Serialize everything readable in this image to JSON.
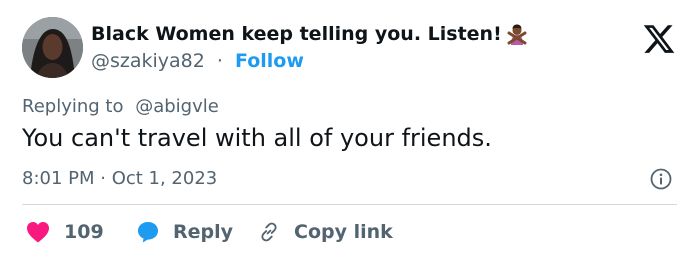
{
  "tweet": {
    "author": {
      "display_name": "Black Women keep telling you. Listen!",
      "emoji_icon": "person-gesturing-no-emoji",
      "handle": "@szakiya82",
      "separator": "·",
      "follow_label": "Follow"
    },
    "replying_prefix": "Replying to",
    "replying_to": "@abigvle",
    "text": "You can't travel with all of your friends.",
    "timestamp": "8:01 PM · Oct 1, 2023",
    "actions": {
      "like_count": "109",
      "reply_label": "Reply",
      "copy_link_label": "Copy link"
    }
  },
  "colors": {
    "text_primary": "#0f1419",
    "text_secondary": "#536471",
    "link_blue": "#1d9bf0",
    "like_red": "#f91880",
    "divider": "#cfd9de"
  }
}
